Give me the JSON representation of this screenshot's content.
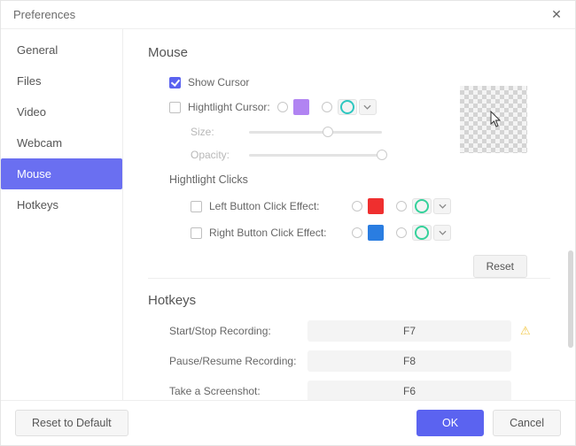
{
  "window": {
    "title": "Preferences",
    "close_icon": "✕"
  },
  "sidebar": {
    "items": [
      {
        "label": "General",
        "id": "general"
      },
      {
        "label": "Files",
        "id": "files"
      },
      {
        "label": "Video",
        "id": "video"
      },
      {
        "label": "Webcam",
        "id": "webcam"
      },
      {
        "label": "Mouse",
        "id": "mouse",
        "active": true
      },
      {
        "label": "Hotkeys",
        "id": "hotkeys"
      }
    ]
  },
  "mouse": {
    "heading": "Mouse",
    "show_cursor_label": "Show Cursor",
    "show_cursor_checked": true,
    "highlight_cursor_label": "Hightlight Cursor:",
    "highlight_cursor_checked": false,
    "highlight_color_solid": "#b184f2",
    "size_label": "Size:",
    "size_value": 0.55,
    "opacity_label": "Opacity:",
    "opacity_value": 1.0,
    "clicks_heading": "Hightlight Clicks",
    "left_click_label": "Left Button Click Effect:",
    "left_click_checked": false,
    "left_click_color": "#ef2f2f",
    "right_click_label": "Right Button Click Effect:",
    "right_click_checked": false,
    "right_click_color": "#2a7de1",
    "reset_label": "Reset"
  },
  "hotkeys": {
    "heading": "Hotkeys",
    "rows": [
      {
        "label": "Start/Stop Recording:",
        "key": "F7",
        "warn": true
      },
      {
        "label": "Pause/Resume Recording:",
        "key": "F8",
        "warn": false
      },
      {
        "label": "Take a Screenshot:",
        "key": "F6",
        "warn": false
      }
    ]
  },
  "footer": {
    "reset_default": "Reset to Default",
    "ok": "OK",
    "cancel": "Cancel"
  }
}
